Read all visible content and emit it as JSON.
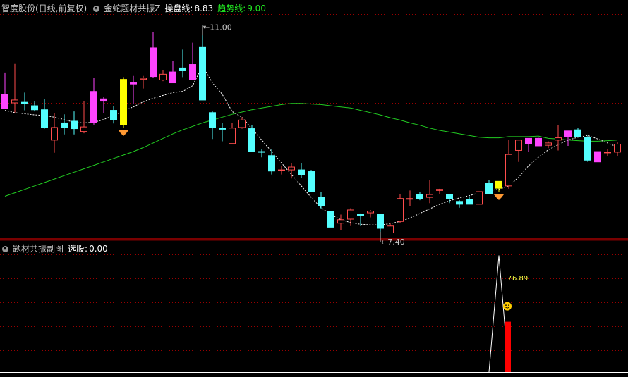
{
  "main_header": {
    "stock_name": "智度股份(日线,前复权)",
    "indicator_name": "金蛇题材共振Z",
    "caopan_label": "操盘线:",
    "caopan_value": "8.83",
    "trend_label": "趋势线:",
    "trend_value": "9.00"
  },
  "sub_header": {
    "indicator_name": "题材共振副图",
    "xuangu_label": "选股:",
    "xuangu_value": "0.00"
  },
  "annotations": {
    "high_label": "11.00",
    "low_label": "7.40",
    "sub_value_a": "7.",
    "sub_value_b": "6.89"
  },
  "colors": {
    "background": "#000000",
    "up_candle": "#ff4d4d",
    "down_candle": "#54ffff",
    "signal_candle": "#ff44ff",
    "buy_candle": "#ffff00",
    "trend_line": "#22cc22",
    "dotted_line": "#ffffff",
    "grid": "#990000",
    "header_gray": "#c8c8c8",
    "header_value": "#ffffff",
    "trend_text": "#22ee22",
    "sub_bar": "#ff0000",
    "sub_text": "#ffff44"
  },
  "chart_data": [
    {
      "type": "candlestick",
      "price_range": [
        7.3,
        11.2
      ],
      "candles": [
        {
          "o": 9.8,
          "h": 10.18,
          "l": 9.55,
          "c": 9.55,
          "style": "signal"
        },
        {
          "o": 9.65,
          "h": 10.33,
          "l": 9.48,
          "c": 9.7,
          "style": "up"
        },
        {
          "o": 9.64,
          "h": 9.83,
          "l": 9.52,
          "c": 9.66,
          "style": "down"
        },
        {
          "o": 9.6,
          "h": 9.68,
          "l": 9.5,
          "c": 9.53,
          "style": "down"
        },
        {
          "o": 9.53,
          "h": 9.72,
          "l": 9.2,
          "c": 9.22,
          "style": "down"
        },
        {
          "o": 9.0,
          "h": 9.47,
          "l": 8.78,
          "c": 9.22,
          "style": "up"
        },
        {
          "o": 9.3,
          "h": 9.45,
          "l": 9.1,
          "c": 9.22,
          "style": "down"
        },
        {
          "o": 9.2,
          "h": 9.5,
          "l": 9.1,
          "c": 9.33,
          "style": "down"
        },
        {
          "o": 9.15,
          "h": 9.68,
          "l": 9.12,
          "c": 9.23,
          "style": "up"
        },
        {
          "o": 9.85,
          "h": 10.08,
          "l": 9.27,
          "c": 9.3,
          "style": "signal"
        },
        {
          "o": 9.68,
          "h": 9.76,
          "l": 9.47,
          "c": 9.72,
          "style": "signal"
        },
        {
          "o": 9.52,
          "h": 9.6,
          "l": 9.29,
          "c": 9.35,
          "style": "down"
        },
        {
          "o": 10.06,
          "h": 10.1,
          "l": 9.22,
          "c": 9.27,
          "style": "buy"
        },
        {
          "o": 9.98,
          "h": 10.12,
          "l": 9.63,
          "c": 10.0,
          "style": "signal"
        },
        {
          "o": 10.06,
          "h": 10.12,
          "l": 9.9,
          "c": 10.08,
          "style": "up"
        },
        {
          "o": 10.61,
          "h": 10.88,
          "l": 10.08,
          "c": 10.11,
          "style": "signal"
        },
        {
          "o": 10.15,
          "h": 10.22,
          "l": 10.03,
          "c": 10.05,
          "style": "up"
        },
        {
          "o": 10.19,
          "h": 10.38,
          "l": 10.0,
          "c": 10.0,
          "style": "signal"
        },
        {
          "o": 10.21,
          "h": 10.58,
          "l": 10.1,
          "c": 10.26,
          "style": "down"
        },
        {
          "o": 10.32,
          "h": 10.7,
          "l": 10.05,
          "c": 10.06,
          "style": "signal"
        },
        {
          "o": 10.63,
          "h": 11.0,
          "l": 10.02,
          "c": 9.7,
          "style": "down"
        },
        {
          "o": 9.48,
          "h": 9.5,
          "l": 9.02,
          "c": 9.22,
          "style": "down"
        },
        {
          "o": 9.21,
          "h": 9.3,
          "l": 8.98,
          "c": 9.19,
          "style": "down"
        },
        {
          "o": 8.94,
          "h": 9.3,
          "l": 8.94,
          "c": 9.21,
          "style": "up"
        },
        {
          "o": 9.35,
          "h": 9.4,
          "l": 9.2,
          "c": 9.22,
          "style": "up"
        },
        {
          "o": 9.2,
          "h": 9.26,
          "l": 8.88,
          "c": 8.8,
          "style": "down"
        },
        {
          "o": 8.8,
          "h": 8.84,
          "l": 8.7,
          "c": 8.8,
          "style": "down"
        },
        {
          "o": 8.73,
          "h": 8.84,
          "l": 8.4,
          "c": 8.46,
          "style": "down"
        },
        {
          "o": 8.48,
          "h": 8.55,
          "l": 8.4,
          "c": 8.47,
          "style": "up"
        },
        {
          "o": 8.48,
          "h": 8.6,
          "l": 8.33,
          "c": 8.53,
          "style": "up"
        },
        {
          "o": 8.48,
          "h": 8.6,
          "l": 8.34,
          "c": 8.4,
          "style": "down"
        },
        {
          "o": 8.45,
          "h": 8.48,
          "l": 8.1,
          "c": 8.1,
          "style": "down"
        },
        {
          "o": 8.0,
          "h": 8.1,
          "l": 7.8,
          "c": 7.85,
          "style": "down"
        },
        {
          "o": 7.75,
          "h": 7.75,
          "l": 7.48,
          "c": 7.48,
          "style": "down"
        },
        {
          "o": 7.55,
          "h": 7.7,
          "l": 7.43,
          "c": 7.61,
          "style": "up"
        },
        {
          "o": 7.62,
          "h": 7.81,
          "l": 7.5,
          "c": 7.78,
          "style": "up"
        },
        {
          "o": 7.7,
          "h": 7.72,
          "l": 7.5,
          "c": 7.7,
          "style": "down"
        },
        {
          "o": 7.73,
          "h": 7.78,
          "l": 7.65,
          "c": 7.76,
          "style": "up"
        },
        {
          "o": 7.7,
          "h": 7.71,
          "l": 7.4,
          "c": 7.46,
          "style": "down"
        },
        {
          "o": 7.38,
          "h": 7.55,
          "l": 7.4,
          "c": 7.5,
          "style": "up"
        },
        {
          "o": 7.58,
          "h": 8.05,
          "l": 7.55,
          "c": 7.98,
          "style": "up"
        },
        {
          "o": 7.97,
          "h": 8.12,
          "l": 7.85,
          "c": 7.98,
          "style": "up"
        },
        {
          "o": 8.05,
          "h": 8.1,
          "l": 7.95,
          "c": 7.98,
          "style": "down"
        },
        {
          "o": 8.05,
          "h": 8.3,
          "l": 7.9,
          "c": 8.0,
          "style": "up"
        },
        {
          "o": 8.12,
          "h": 8.15,
          "l": 8.05,
          "c": 8.14,
          "style": "up"
        },
        {
          "o": 8.05,
          "h": 8.05,
          "l": 7.9,
          "c": 7.98,
          "style": "down"
        },
        {
          "o": 7.93,
          "h": 7.95,
          "l": 7.82,
          "c": 7.88,
          "style": "down"
        },
        {
          "o": 7.97,
          "h": 8.02,
          "l": 7.9,
          "c": 7.88,
          "style": "down"
        },
        {
          "o": 7.88,
          "h": 8.1,
          "l": 7.88,
          "c": 8.1,
          "style": "up"
        },
        {
          "o": 8.25,
          "h": 8.3,
          "l": 8.05,
          "c": 8.06,
          "style": "down"
        },
        {
          "o": 8.28,
          "h": 8.27,
          "l": 8.1,
          "c": 8.16,
          "style": "buy"
        },
        {
          "o": 8.2,
          "h": 9.0,
          "l": 8.15,
          "c": 8.75,
          "style": "up"
        },
        {
          "o": 8.82,
          "h": 9.0,
          "l": 8.62,
          "c": 9.0,
          "style": "up"
        },
        {
          "o": 8.93,
          "h": 9.03,
          "l": 8.79,
          "c": 9.03,
          "style": "signal"
        },
        {
          "o": 9.03,
          "h": 9.04,
          "l": 8.9,
          "c": 8.9,
          "style": "signal"
        },
        {
          "o": 8.95,
          "h": 8.98,
          "l": 8.86,
          "c": 8.91,
          "style": "up"
        },
        {
          "o": 9.0,
          "h": 9.26,
          "l": 8.82,
          "c": 9.04,
          "style": "up"
        },
        {
          "o": 9.06,
          "h": 9.14,
          "l": 8.9,
          "c": 9.16,
          "style": "signal"
        },
        {
          "o": 9.18,
          "h": 9.22,
          "l": 9.05,
          "c": 9.06,
          "style": "down"
        },
        {
          "o": 9.05,
          "h": 9.08,
          "l": 8.62,
          "c": 8.65,
          "style": "down"
        },
        {
          "o": 8.8,
          "h": 8.8,
          "l": 8.62,
          "c": 8.62,
          "style": "signal"
        },
        {
          "o": 8.79,
          "h": 8.84,
          "l": 8.72,
          "c": 8.78,
          "style": "up"
        },
        {
          "o": 8.79,
          "h": 8.96,
          "l": 8.72,
          "c": 8.93,
          "style": "up"
        }
      ],
      "caopan_line": [
        9.52,
        9.48,
        9.46,
        9.44,
        9.43,
        9.4,
        9.36,
        9.31,
        9.3,
        9.31,
        9.36,
        9.43,
        9.51,
        9.58,
        9.67,
        9.73,
        9.78,
        9.83,
        9.85,
        9.95,
        10.3,
        10.0,
        9.8,
        9.5,
        9.4,
        9.2,
        9.0,
        8.8,
        8.6,
        8.4,
        8.2,
        8.0,
        7.82,
        7.7,
        7.61,
        7.56,
        7.53,
        7.52,
        7.52,
        7.54,
        7.58,
        7.64,
        7.72,
        7.8,
        7.88,
        7.94,
        7.99,
        8.03,
        8.08,
        8.12,
        8.14,
        8.2,
        8.35,
        8.55,
        8.7,
        8.83,
        8.92,
        9.0,
        9.05,
        9.08,
        9.02,
        8.95,
        8.88
      ],
      "trend_line": [
        8.02,
        8.08,
        8.14,
        8.2,
        8.26,
        8.32,
        8.38,
        8.44,
        8.5,
        8.56,
        8.62,
        8.68,
        8.74,
        8.8,
        8.87,
        8.95,
        9.03,
        9.11,
        9.18,
        9.24,
        9.3,
        9.35,
        9.4,
        9.45,
        9.49,
        9.53,
        9.56,
        9.59,
        9.62,
        9.64,
        9.64,
        9.63,
        9.62,
        9.6,
        9.58,
        9.56,
        9.52,
        9.48,
        9.44,
        9.39,
        9.35,
        9.3,
        9.26,
        9.21,
        9.17,
        9.14,
        9.11,
        9.08,
        9.05,
        9.04,
        9.04,
        9.06,
        9.06,
        9.06,
        9.07,
        9.03,
        9.02,
        9.0,
        8.99,
        8.98,
        8.98,
        8.99,
        9.0
      ]
    },
    {
      "type": "line",
      "series": [
        {
          "values": [
            0,
            0,
            0,
            0,
            0,
            0,
            0,
            0,
            0,
            0,
            0,
            0,
            0,
            0,
            0,
            0,
            0,
            0,
            0,
            0,
            0,
            0,
            0,
            0,
            0,
            0,
            0,
            0,
            0,
            0,
            0,
            0,
            0,
            0,
            0,
            0,
            0,
            0,
            0,
            0,
            0,
            0,
            0,
            0,
            0,
            0,
            0,
            0,
            0,
            0,
            0,
            0,
            0,
            0,
            0,
            0,
            0,
            0,
            0,
            0,
            0,
            0,
            0
          ]
        },
        {
          "values": [
            0,
            0,
            0,
            0,
            0,
            0,
            0,
            0,
            0,
            0,
            0,
            0,
            0,
            0,
            0,
            0,
            0,
            0,
            0,
            0,
            0,
            0,
            0,
            0,
            0,
            0,
            0,
            0,
            0,
            0,
            0,
            0,
            0,
            0,
            0,
            0,
            0,
            0,
            0,
            0,
            0,
            0,
            0,
            0,
            0,
            0,
            0,
            0,
            0,
            0,
            0,
            0,
            0,
            0,
            0,
            0,
            0,
            0,
            0,
            0,
            0,
            0,
            0
          ]
        }
      ],
      "spike": {
        "index": 50,
        "peak": 7.88,
        "bar_value": 3.4,
        "bar_offset": 0.5,
        "label_value": 6.89
      },
      "ylim": [
        0,
        8.0
      ]
    }
  ]
}
